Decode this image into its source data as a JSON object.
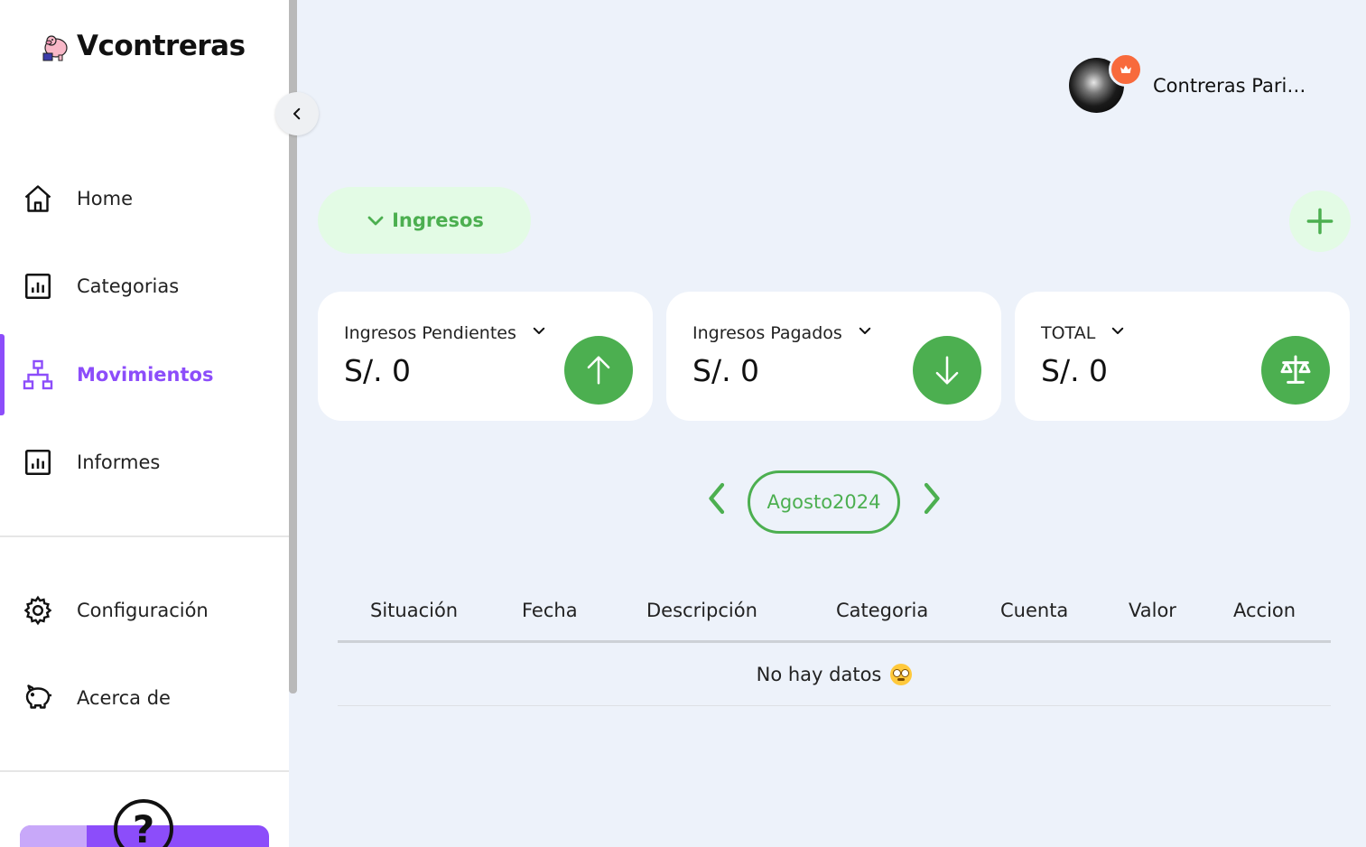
{
  "app": {
    "brand_name": "Vcontreras"
  },
  "sidebar": {
    "items": [
      {
        "label": "Home",
        "icon": "home-icon",
        "active": false
      },
      {
        "label": "Categorias",
        "icon": "chart-icon",
        "active": false
      },
      {
        "label": "Movimientos",
        "icon": "hierarchy-icon",
        "active": true
      },
      {
        "label": "Informes",
        "icon": "chart-icon",
        "active": false
      }
    ],
    "secondary_items": [
      {
        "label": "Configuración",
        "icon": "gear-icon"
      },
      {
        "label": "Acerca de",
        "icon": "piggy-bank-icon"
      }
    ],
    "help_icon_text": "?"
  },
  "header": {
    "user_name": "Contreras Paricahua"
  },
  "movements": {
    "type_label": "Ingresos",
    "cards": [
      {
        "title": "Ingresos Pendientes",
        "value": "S/. 0",
        "icon": "arrow-up-icon"
      },
      {
        "title": "Ingresos Pagados",
        "value": "S/. 0",
        "icon": "arrow-down-icon"
      },
      {
        "title": "TOTAL",
        "value": "S/. 0",
        "icon": "scale-icon"
      }
    ],
    "month_label": "Agosto2024",
    "table": {
      "columns": [
        "Situación",
        "Fecha",
        "Descripción",
        "Categoria",
        "Cuenta",
        "Valor",
        "Accion"
      ],
      "empty_text": "No hay datos"
    }
  },
  "colors": {
    "accent_purple": "#8c4dfa",
    "accent_green": "#4caf50",
    "background": "#edf2fa",
    "card": "#ffffff",
    "avatar_badge": "#f86a3c"
  }
}
